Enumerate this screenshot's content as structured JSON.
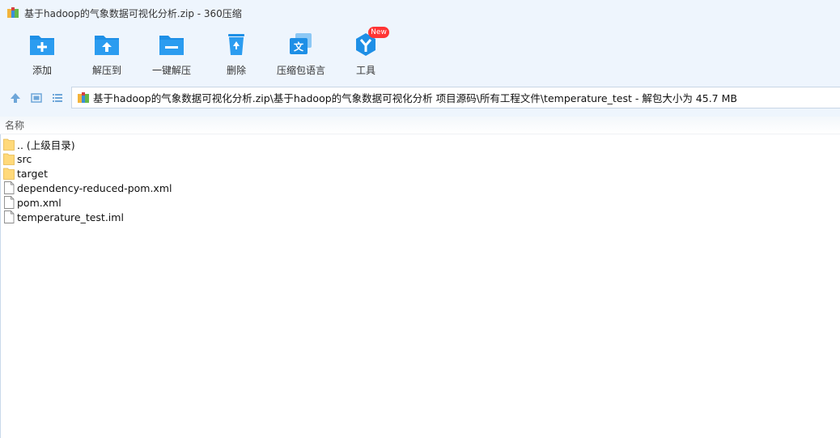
{
  "window": {
    "title": "基于hadoop的气象数据可视化分析.zip - 360压缩"
  },
  "toolbar": {
    "items": [
      {
        "label": "添加",
        "icon": "add-folder-icon"
      },
      {
        "label": "解压到",
        "icon": "extract-to-folder-icon"
      },
      {
        "label": "一键解压",
        "icon": "one-click-extract-folder-icon"
      },
      {
        "label": "删除",
        "icon": "recycle-bin-icon"
      },
      {
        "label": "压缩包语言",
        "icon": "language-icon"
      },
      {
        "label": "工具",
        "icon": "tools-icon"
      }
    ],
    "new_badge": "New"
  },
  "addressbar": {
    "path": "基于hadoop的气象数据可视化分析.zip\\基于hadoop的气象数据可视化分析 项目源码\\所有工程文件\\temperature_test - 解包大小为 45.7 MB"
  },
  "filelist": {
    "column_name": "名称",
    "items": [
      {
        "name": ".. (上级目录)",
        "type": "folder"
      },
      {
        "name": "src",
        "type": "folder"
      },
      {
        "name": "target",
        "type": "folder"
      },
      {
        "name": "dependency-reduced-pom.xml",
        "type": "file"
      },
      {
        "name": "pom.xml",
        "type": "file"
      },
      {
        "name": "temperature_test.iml",
        "type": "file"
      }
    ]
  },
  "colors": {
    "accent": "#1e8fe6",
    "chrome_bg": "#eef5fd",
    "folder": "#ffd97a",
    "badge": "#ff3535"
  }
}
